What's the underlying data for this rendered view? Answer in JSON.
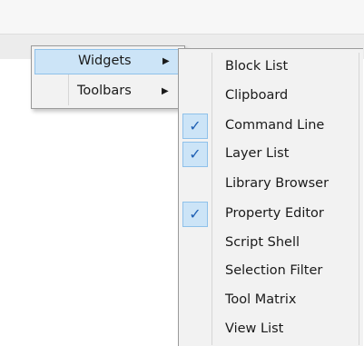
{
  "menu": {
    "items": [
      {
        "label": "Widgets",
        "highlighted": true
      },
      {
        "label": "Toolbars",
        "highlighted": false
      }
    ]
  },
  "submenu": {
    "items": [
      {
        "label": "Block List",
        "checked": false
      },
      {
        "label": "Clipboard",
        "checked": false
      },
      {
        "label": "Command Line",
        "checked": true
      },
      {
        "label": "Layer List",
        "checked": true
      },
      {
        "label": "Library Browser",
        "checked": false
      },
      {
        "label": "Property Editor",
        "checked": true
      },
      {
        "label": "Script Shell",
        "checked": false
      },
      {
        "label": "Selection Filter",
        "checked": false
      },
      {
        "label": "Tool Matrix",
        "checked": false
      },
      {
        "label": "View List",
        "checked": false
      }
    ],
    "check_glyph": "✓"
  },
  "colors": {
    "highlight": "#cce4f7",
    "highlight_border": "#8fc1ea",
    "check": "#1e5fb3",
    "menu_bg": "#f2f2f2"
  }
}
